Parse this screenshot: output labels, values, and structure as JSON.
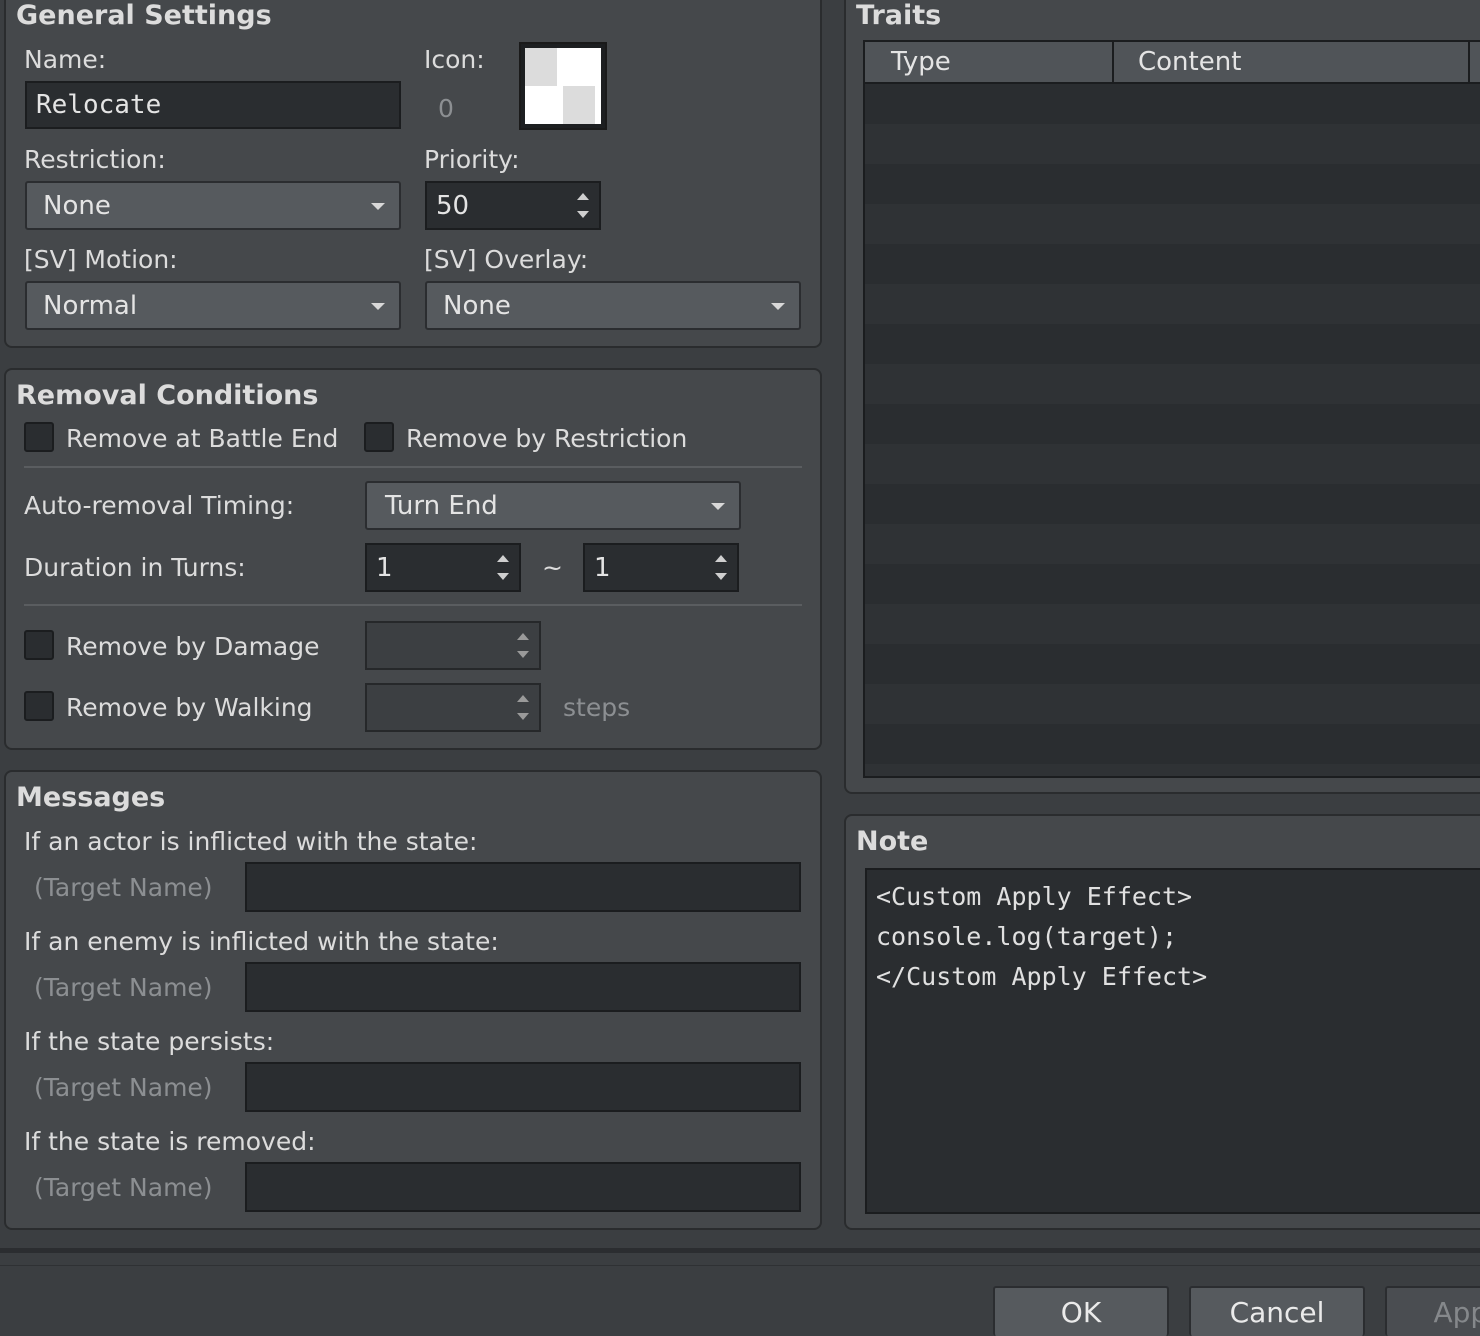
{
  "general": {
    "title": "General Settings",
    "name_label": "Name:",
    "name_value": "Relocate",
    "icon_label": "Icon:",
    "icon_index": "0",
    "restriction_label": "Restriction:",
    "restriction_value": "None",
    "priority_label": "Priority:",
    "priority_value": "50",
    "motion_label": "[SV] Motion:",
    "motion_value": "Normal",
    "overlay_label": "[SV] Overlay:",
    "overlay_value": "None"
  },
  "removal": {
    "title": "Removal Conditions",
    "battle_end_label": "Remove at Battle End",
    "restriction_label": "Remove by Restriction",
    "timing_label": "Auto-removal Timing:",
    "timing_value": "Turn End",
    "duration_label": "Duration in Turns:",
    "duration_min": "1",
    "duration_tilde": "~",
    "duration_max": "1",
    "damage_label": "Remove by Damage",
    "walking_label": "Remove by Walking",
    "steps_label": "steps"
  },
  "messages": {
    "title": "Messages",
    "actor_label": "If an actor is inflicted with the state:",
    "enemy_label": "If an enemy is inflicted with the state:",
    "persists_label": "If the state persists:",
    "removed_label": "If the state is removed:",
    "target_name": "(Target Name)"
  },
  "traits": {
    "title": "Traits",
    "col_type": "Type",
    "col_content": "Content"
  },
  "note": {
    "title": "Note",
    "line1": "<Custom Apply Effect>",
    "line2": "console.log(target);",
    "line3": "</Custom Apply Effect>"
  },
  "buttons": {
    "ok": "OK",
    "cancel": "Cancel",
    "apply": "Apply"
  },
  "colors": {
    "background": "#3b3e41",
    "panel": "#45484b",
    "field": "#2a2d30",
    "button": "#565a5e"
  }
}
